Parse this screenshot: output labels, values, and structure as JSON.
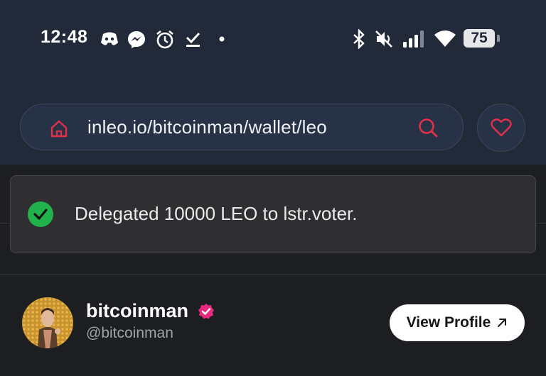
{
  "status_bar": {
    "time": "12:48",
    "battery": "75",
    "icons": [
      "discord-icon",
      "messenger-icon",
      "alarm-icon",
      "checkmark-icon",
      "dot-icon",
      "bluetooth-icon",
      "mute-icon",
      "signal-icon",
      "wifi-icon",
      "battery-icon"
    ]
  },
  "browser": {
    "url": "inleo.io/bitcoinman/wallet/leo",
    "icons": [
      "home-icon",
      "search-icon",
      "heart-icon"
    ]
  },
  "toast": {
    "message": "Delegated 10000 LEO to lstr.voter.",
    "icon": "check-circle-icon",
    "color": "#22b24c"
  },
  "profile": {
    "name": "bitcoinman",
    "handle": "@bitcoinman",
    "verified_color": "#e6287f",
    "view_profile_label": "View Profile",
    "view_profile_icon": "arrow-up-right-icon"
  },
  "colors": {
    "accent": "#e0304a",
    "header_bg": "#222a3a",
    "page_bg": "#1d1e22"
  }
}
